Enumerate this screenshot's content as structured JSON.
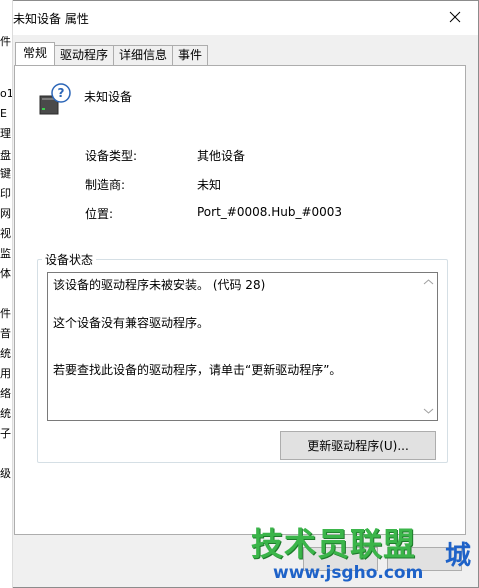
{
  "window": {
    "title": "未知设备 属性"
  },
  "tabs": [
    {
      "label": "常规",
      "active": true
    },
    {
      "label": "驱动程序",
      "active": false
    },
    {
      "label": "详细信息",
      "active": false
    },
    {
      "label": "事件",
      "active": false
    }
  ],
  "device": {
    "icon": "unknown-device-icon",
    "name": "未知设备"
  },
  "properties": [
    {
      "label": "设备类型:",
      "value": "其他设备"
    },
    {
      "label": "制造商:",
      "value": "未知"
    },
    {
      "label": "位置:",
      "value": "Port_#0008.Hub_#0003"
    }
  ],
  "device_status": {
    "title": "设备状态",
    "lines": [
      "该设备的驱动程序未被安装。 (代码 28)",
      "这个设备没有兼容驱动程序。",
      "若要查找此设备的驱动程序，请单击“更新驱动程序”。"
    ]
  },
  "update_button": "更新驱动程序(U)...",
  "behind_window_fragments": [
    "件",
    "o1",
    "E",
    "理",
    "盘",
    "键",
    "印",
    "网",
    "视",
    "监",
    "体",
    "件",
    "音",
    "统",
    "用",
    "络",
    "统",
    "子",
    "级"
  ],
  "watermark": {
    "main": "技术员联盟",
    "cheng": "城",
    "url": "www.jsgho.com",
    "colors": {
      "green": "#3bb54a",
      "blue": "#1e62c8"
    }
  }
}
